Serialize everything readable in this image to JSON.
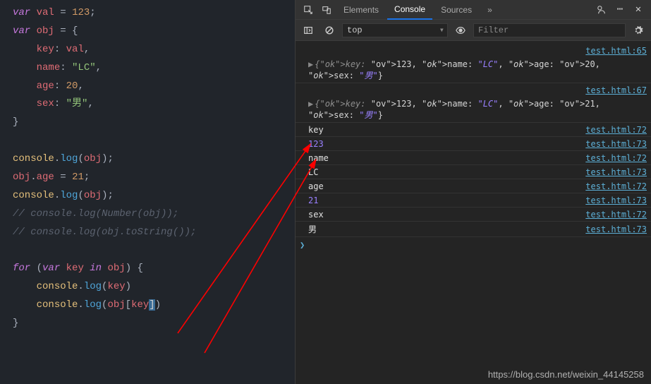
{
  "editor": {
    "lines": [
      [
        [
          "kw",
          "var"
        ],
        [
          "punc",
          " "
        ],
        [
          "var",
          "val"
        ],
        [
          "punc",
          " = "
        ],
        [
          "num",
          "123"
        ],
        [
          "punc",
          ";"
        ]
      ],
      [
        [
          "kw",
          "var"
        ],
        [
          "punc",
          " "
        ],
        [
          "var",
          "obj"
        ],
        [
          "punc",
          " = {"
        ]
      ],
      [
        [
          "punc",
          "    "
        ],
        [
          "prop",
          "key"
        ],
        [
          "punc",
          ": "
        ],
        [
          "var",
          "val"
        ],
        [
          "punc",
          ","
        ]
      ],
      [
        [
          "punc",
          "    "
        ],
        [
          "prop",
          "name"
        ],
        [
          "punc",
          ": "
        ],
        [
          "str",
          "\"LC\""
        ],
        [
          "punc",
          ","
        ]
      ],
      [
        [
          "punc",
          "    "
        ],
        [
          "prop",
          "age"
        ],
        [
          "punc",
          ": "
        ],
        [
          "num",
          "20"
        ],
        [
          "punc",
          ","
        ]
      ],
      [
        [
          "punc",
          "    "
        ],
        [
          "prop",
          "sex"
        ],
        [
          "punc",
          ": "
        ],
        [
          "str",
          "\"男\""
        ],
        [
          "punc",
          ","
        ]
      ],
      [
        [
          "punc",
          "}"
        ]
      ],
      [
        [
          "punc",
          " "
        ]
      ],
      [
        [
          "builtin",
          "console"
        ],
        [
          "punc",
          "."
        ],
        [
          "fn",
          "log"
        ],
        [
          "punc",
          "("
        ],
        [
          "var",
          "obj"
        ],
        [
          "punc",
          ");"
        ]
      ],
      [
        [
          "var",
          "obj"
        ],
        [
          "punc",
          "."
        ],
        [
          "prop",
          "age"
        ],
        [
          "punc",
          " = "
        ],
        [
          "num",
          "21"
        ],
        [
          "punc",
          ";"
        ]
      ],
      [
        [
          "builtin",
          "console"
        ],
        [
          "punc",
          "."
        ],
        [
          "fn",
          "log"
        ],
        [
          "punc",
          "("
        ],
        [
          "var",
          "obj"
        ],
        [
          "punc",
          ");"
        ]
      ],
      [
        [
          "comment",
          "// console.log(Number(obj));"
        ]
      ],
      [
        [
          "comment",
          "// console.log(obj.toString());"
        ]
      ],
      [
        [
          "punc",
          " "
        ]
      ],
      [
        [
          "kw",
          "for"
        ],
        [
          "punc",
          " ("
        ],
        [
          "kw",
          "var"
        ],
        [
          "punc",
          " "
        ],
        [
          "var",
          "key"
        ],
        [
          "punc",
          " "
        ],
        [
          "kw",
          "in"
        ],
        [
          "punc",
          " "
        ],
        [
          "var",
          "obj"
        ],
        [
          "punc",
          ") {"
        ]
      ],
      [
        [
          "punc",
          "    "
        ],
        [
          "builtin",
          "console"
        ],
        [
          "punc",
          "."
        ],
        [
          "fn",
          "log"
        ],
        [
          "punc",
          "("
        ],
        [
          "var",
          "key"
        ],
        [
          "punc",
          ")"
        ]
      ],
      [
        [
          "punc",
          "    "
        ],
        [
          "builtin",
          "console"
        ],
        [
          "punc",
          "."
        ],
        [
          "fn",
          "log"
        ],
        [
          "punc",
          "("
        ],
        [
          "var",
          "obj"
        ],
        [
          "punc",
          "["
        ],
        [
          "var",
          "key"
        ],
        [
          "sel",
          "]"
        ],
        [
          "punc",
          ")"
        ]
      ],
      [
        [
          "punc",
          "}"
        ]
      ]
    ]
  },
  "devtools": {
    "tabs": {
      "elements": "Elements",
      "console": "Console",
      "sources": "Sources",
      "more": "»"
    },
    "context": "top",
    "filter_placeholder": "Filter",
    "srcfile": "test.html",
    "logs": [
      {
        "type": "link-only",
        "src": "test.html:65"
      },
      {
        "type": "obj",
        "text": "{key: 123, name: \"LC\", age: 20, sex: \"男\"}"
      },
      {
        "type": "link-only",
        "src": "test.html:67"
      },
      {
        "type": "obj",
        "text": "{key: 123, name: \"LC\", age: 21, sex: \"男\"}"
      },
      {
        "type": "str",
        "text": "key",
        "src": "test.html:72"
      },
      {
        "type": "num",
        "text": "123",
        "src": "test.html:73"
      },
      {
        "type": "str",
        "text": "name",
        "src": "test.html:72"
      },
      {
        "type": "str",
        "text": "LC",
        "src": "test.html:73"
      },
      {
        "type": "str",
        "text": "age",
        "src": "test.html:72"
      },
      {
        "type": "num",
        "text": "21",
        "src": "test.html:73"
      },
      {
        "type": "str",
        "text": "sex",
        "src": "test.html:72"
      },
      {
        "type": "str",
        "text": "男",
        "src": "test.html:73"
      }
    ],
    "object_display": {
      "line1": {
        "key": 123,
        "name": "LC",
        "age": 20,
        "sex": "男"
      },
      "line2": {
        "key": 123,
        "name": "LC",
        "age": 21,
        "sex": "男"
      }
    }
  },
  "watermark": "https://blog.csdn.net/weixin_44145258"
}
